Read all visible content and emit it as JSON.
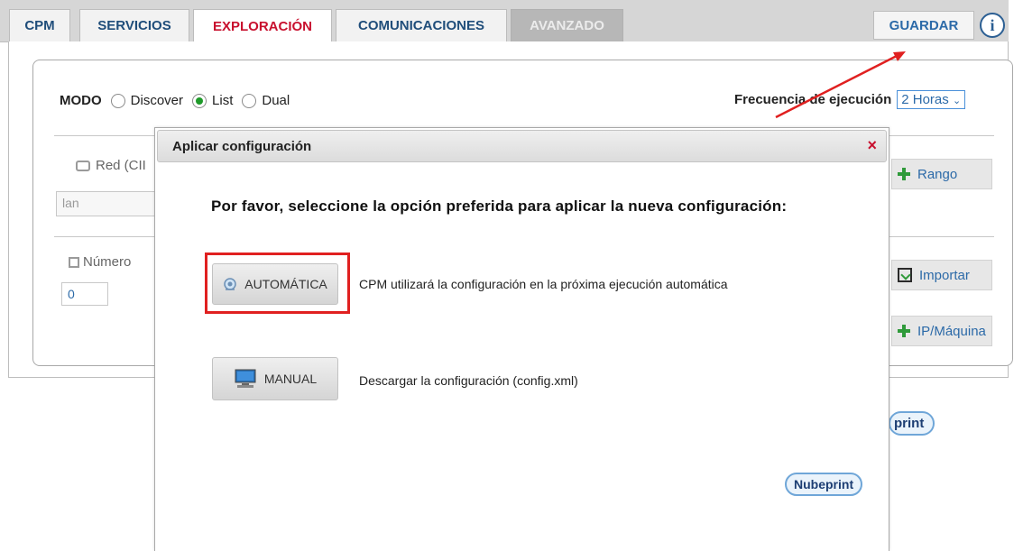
{
  "tabs": [
    {
      "label": "CPM",
      "state": "normal"
    },
    {
      "label": "SERVICIOS",
      "state": "normal"
    },
    {
      "label": "EXPLORACIÓN",
      "state": "active"
    },
    {
      "label": "COMUNICACIONES",
      "state": "normal"
    },
    {
      "label": "AVANZADO",
      "state": "disabled"
    }
  ],
  "header": {
    "save_label": "GUARDAR",
    "info_glyph": "i",
    "info_icon": "info-circle-icon"
  },
  "mode": {
    "label": "MODO",
    "options": [
      {
        "label": "Discover",
        "selected": false
      },
      {
        "label": "List",
        "selected": true
      },
      {
        "label": "Dual",
        "selected": false
      }
    ]
  },
  "frequency": {
    "label": "Frecuencia de ejecución",
    "value": "2 Horas"
  },
  "network": {
    "label": "Red (CII",
    "input_value": "lan",
    "add_range_label": "Rango"
  },
  "number": {
    "label": "Número",
    "value": "0",
    "import_label": "Importar",
    "add_ip_label": "IP/Máquina"
  },
  "background_logo_text": "print",
  "dialog": {
    "title": "Aplicar configuración",
    "close_glyph": "×",
    "message": "Por favor, seleccione la opción preferida para aplicar la nueva configuración:",
    "options": [
      {
        "label": "AUTOMÁTICA",
        "icon": "satellite-icon",
        "description": "CPM utilizará la configuración en la próxima ejecución automática"
      },
      {
        "label": "MANUAL",
        "icon": "monitor-icon",
        "description": "Descargar la configuración (config.xml)"
      }
    ],
    "logo_text": "Nubeprint"
  },
  "colors": {
    "active_tab": "#c8102e",
    "tab_text": "#1f4d7a",
    "highlight": "#e02020",
    "link_blue": "#2c6aa8",
    "plus_green": "#2f9a3a"
  }
}
